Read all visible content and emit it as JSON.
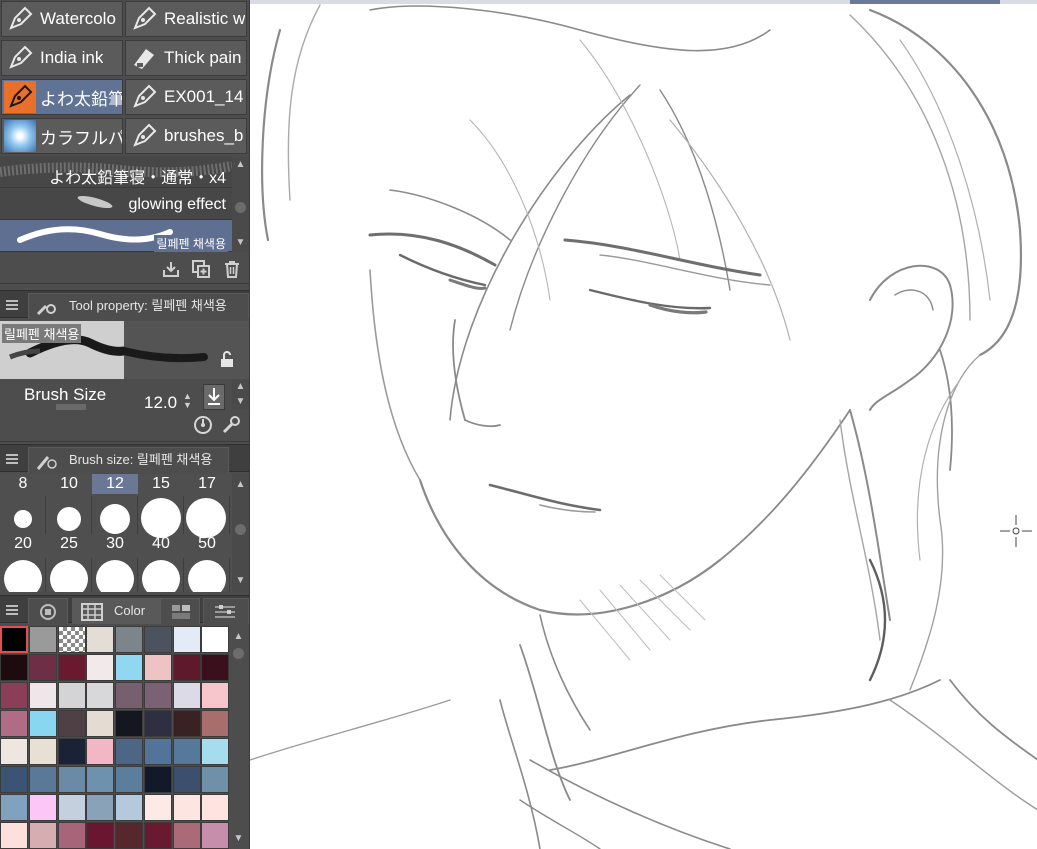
{
  "brush_tiles": [
    {
      "label": "Watercolo",
      "icon": "pen-nib-icon",
      "active": false
    },
    {
      "label": "Realistic w",
      "icon": "pen-nib-icon",
      "active": false
    },
    {
      "label": "India ink",
      "icon": "pen-nib-icon",
      "active": false
    },
    {
      "label": "Thick pain",
      "icon": "paint-tube-icon",
      "active": false
    },
    {
      "label": "よわ太鉛筆",
      "icon": "pencil-orange-icon",
      "active": true
    },
    {
      "label": "EX001_14",
      "icon": "pen-nib-icon",
      "active": false
    },
    {
      "label": "カラフルパー",
      "icon": "colorful-sparkle-icon",
      "active": false
    },
    {
      "label": "brushes_b",
      "icon": "pen-nib-icon",
      "active": false
    }
  ],
  "brush_list": [
    {
      "label": "よわ太鉛筆寝・通常・x4",
      "selected": false
    },
    {
      "label": "glowing effect",
      "selected": false
    },
    {
      "label": "릴페펜 채색용",
      "selected": true
    }
  ],
  "tool_property": {
    "tab_title": "Tool property: 릴페펜 채색용",
    "preview_label": "릴페펜 채색용",
    "brush_size_label": "Brush Size",
    "brush_size_value": "12.0"
  },
  "brush_size_panel": {
    "tab_title": "Brush size: 릴페펜 채색용",
    "top_sizes": [
      "8",
      "10",
      "12",
      "15",
      "17"
    ],
    "selected_size": "12",
    "mid_sizes": [
      "20",
      "25",
      "30",
      "40",
      "50"
    ]
  },
  "color_panel": {
    "tab_label": "Color",
    "swatches": [
      [
        "#000000",
        "#9a9a9a",
        "checker",
        "#e4ddd6",
        "#7d858c",
        "#4d535e",
        "#e2ebf6",
        "#ffffff"
      ],
      [
        "#1e0b10",
        "#6e2e45",
        "#6a1a2e",
        "#f2eaea",
        "#8fd8f0",
        "#eec3c4",
        "#5e1a2c",
        "#3a101c"
      ],
      [
        "#8a3e58",
        "#efe6e9",
        "#d4d4d6",
        "#d8d8da",
        "#76606e",
        "#7a6274",
        "#dcdae6",
        "#f6c6cc"
      ],
      [
        "#b06c84",
        "#88d6f0",
        "#4e4044",
        "#e4dcd2",
        "#141620",
        "#2e3042",
        "#3a2224",
        "#a86e6c"
      ],
      [
        "#efe6e2",
        "#e8e0d4",
        "#1a2236",
        "#f2b6c6",
        "#4e6686",
        "#52749a",
        "#56789a",
        "#a6dcee"
      ],
      [
        "#3c5474",
        "#5a7898",
        "#6a8aa6",
        "#6e92ae",
        "#5a7e9c",
        "#121a2a",
        "#3c506e",
        "#7090aa"
      ],
      [
        "#80a2be",
        "#fcc6f6",
        "#c4d0de",
        "#8aa2b8",
        "#b4cadc",
        "#fdeae6",
        "#fde6e2",
        "#fde4e0"
      ],
      [
        "#fde0dc",
        "#d6aeb2",
        "#a86478",
        "#6a1630",
        "#56282e",
        "#6a1a30",
        "#aa6a78",
        "#c68eaa"
      ]
    ]
  }
}
